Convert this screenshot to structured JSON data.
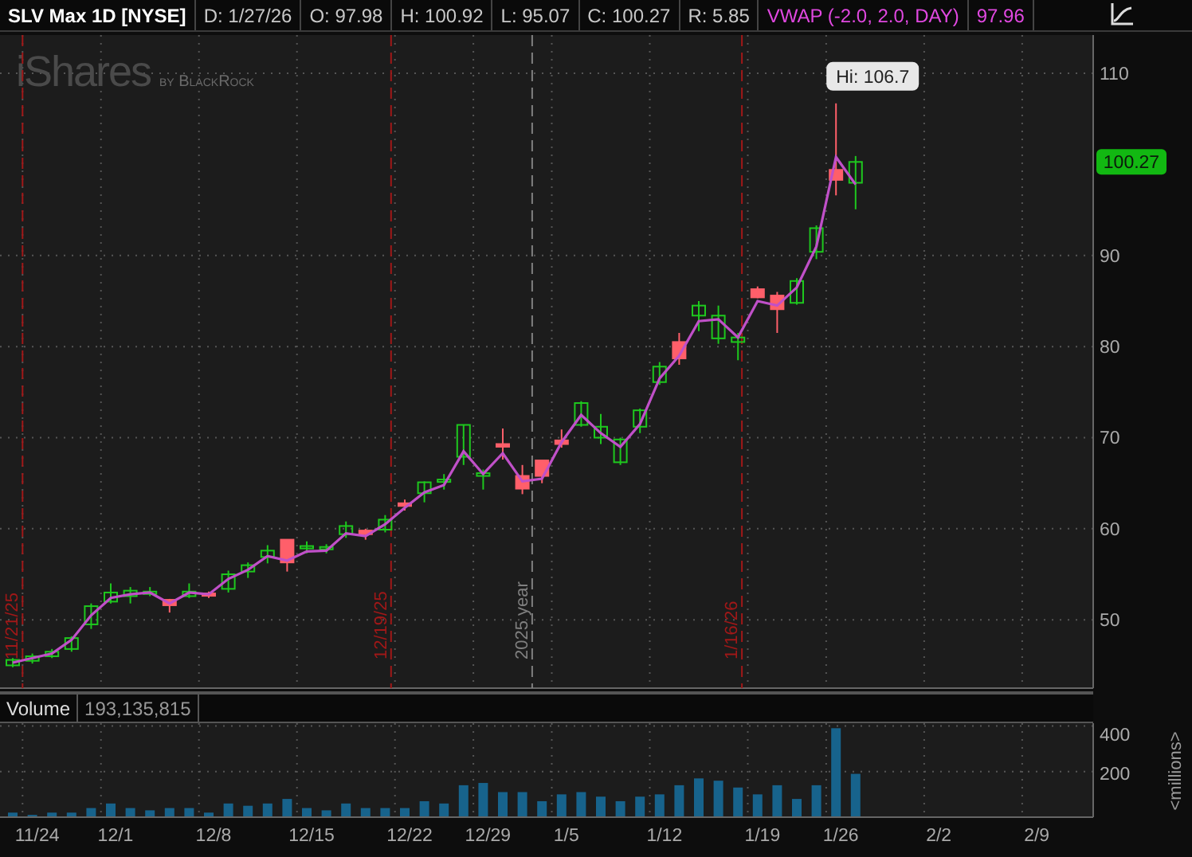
{
  "header": {
    "symbol": "SLV Max 1D [NYSE]",
    "fields": [
      {
        "text": "D: 1/27/26",
        "color": "#c8c8c8"
      },
      {
        "text": "O: 97.98",
        "color": "#c8c8c8"
      },
      {
        "text": "H: 100.92",
        "color": "#c8c8c8"
      },
      {
        "text": "L: 95.07",
        "color": "#c8c8c8"
      },
      {
        "text": "C: 100.27",
        "color": "#c8c8c8"
      },
      {
        "text": "R: 5.85",
        "color": "#c8c8c8"
      },
      {
        "text": "VWAP (-2.0, 2.0, DAY)",
        "color": "#e048e0"
      },
      {
        "text": "97.96",
        "color": "#e048e0"
      }
    ]
  },
  "price_chart": {
    "logo": {
      "name": "iShares",
      "byline": "by BlackRock"
    },
    "markers": [
      {
        "label": "11/21/25",
        "color": "#a01818"
      },
      {
        "label": "12/19/25",
        "color": "#a01818"
      },
      {
        "label": "2025 year",
        "color": "#808080"
      },
      {
        "label": "1/16/26",
        "color": "#a01818"
      }
    ],
    "chart_data": {
      "type": "candlestick",
      "ohlc": [
        [
          45.0,
          45.8,
          44.8,
          45.6
        ],
        [
          45.5,
          46.3,
          45.2,
          46.0
        ],
        [
          46.0,
          46.8,
          45.8,
          46.5
        ],
        [
          46.8,
          48.2,
          46.5,
          48.0
        ],
        [
          49.5,
          51.8,
          49.0,
          51.5
        ],
        [
          52.0,
          54.0,
          51.8,
          53.0
        ],
        [
          52.6,
          53.6,
          51.8,
          53.2
        ],
        [
          52.9,
          53.6,
          52.6,
          53.1
        ],
        [
          52.2,
          52.3,
          50.8,
          51.6
        ],
        [
          52.6,
          54.0,
          52.4,
          53.1
        ],
        [
          52.9,
          53.1,
          52.4,
          52.7
        ],
        [
          53.4,
          55.4,
          53.0,
          55.0
        ],
        [
          55.3,
          56.3,
          54.6,
          56.0
        ],
        [
          56.9,
          58.2,
          56.2,
          57.6
        ],
        [
          58.8,
          58.8,
          55.3,
          56.3
        ],
        [
          57.9,
          58.6,
          57.3,
          58.1
        ],
        [
          57.8,
          58.3,
          57.3,
          58.0
        ],
        [
          59.4,
          60.8,
          59.0,
          60.3
        ],
        [
          59.8,
          60.0,
          58.8,
          59.4
        ],
        [
          59.9,
          61.5,
          59.6,
          61.0
        ],
        [
          62.8,
          63.2,
          62.0,
          62.5
        ],
        [
          63.9,
          65.2,
          62.9,
          65.1
        ],
        [
          65.2,
          66.0,
          64.3,
          65.4
        ],
        [
          67.9,
          71.4,
          67.0,
          71.4
        ],
        [
          65.8,
          66.5,
          64.3,
          66.1
        ],
        [
          69.3,
          71.0,
          67.6,
          69.0
        ],
        [
          65.8,
          67.0,
          63.8,
          64.4
        ],
        [
          67.5,
          67.5,
          65.0,
          65.8
        ],
        [
          69.7,
          70.9,
          68.9,
          69.3
        ],
        [
          71.4,
          74.0,
          71.2,
          73.8
        ],
        [
          70.0,
          72.6,
          69.3,
          71.2
        ],
        [
          67.3,
          70.0,
          67.0,
          69.8
        ],
        [
          71.2,
          73.2,
          70.5,
          73.0
        ],
        [
          76.1,
          78.3,
          75.8,
          77.8
        ],
        [
          80.5,
          81.5,
          78.0,
          78.7
        ],
        [
          83.4,
          85.0,
          81.7,
          84.5
        ],
        [
          80.9,
          84.5,
          80.3,
          83.4
        ],
        [
          80.5,
          81.5,
          78.5,
          81.0
        ],
        [
          86.3,
          86.6,
          85.3,
          85.4
        ],
        [
          85.6,
          86.0,
          81.5,
          84.1
        ],
        [
          84.8,
          87.5,
          84.6,
          87.2
        ],
        [
          90.4,
          93.3,
          89.6,
          93.0
        ],
        [
          99.4,
          106.7,
          96.6,
          98.3
        ],
        [
          97.98,
          100.92,
          95.07,
          100.27
        ]
      ],
      "series": [
        {
          "type": "line",
          "color": "#c050c8",
          "values": [
            45.3,
            45.8,
            46.3,
            47.8,
            50.5,
            52.4,
            52.8,
            53.0,
            51.8,
            53.0,
            52.8,
            54.5,
            55.5,
            57.0,
            56.5,
            57.5,
            57.6,
            59.5,
            59.2,
            60.5,
            62.3,
            64.0,
            64.8,
            68.5,
            66.0,
            68.3,
            65.2,
            65.5,
            69.5,
            72.5,
            70.5,
            69.0,
            71.5,
            76.5,
            79.0,
            82.8,
            83.0,
            81.0,
            85.0,
            84.5,
            86.5,
            91.0,
            100.8,
            97.8
          ]
        }
      ],
      "ylim": [
        42.5,
        114.2
      ],
      "yticks": [
        50,
        60,
        70,
        80,
        90,
        110
      ],
      "grid": true,
      "annotations": [
        "Hi: 106.7",
        "100.27"
      ]
    }
  },
  "volume_chart": {
    "reading": "193,135,815",
    "chart_data": {
      "type": "bar",
      "categories": [
        null,
        "11/24",
        null,
        null,
        null,
        "12/1",
        null,
        null,
        null,
        null,
        "12/8",
        null,
        null,
        null,
        null,
        "12/15",
        null,
        null,
        null,
        null,
        "12/22",
        null,
        null,
        null,
        "12/29",
        null,
        null,
        null,
        "1/5",
        null,
        null,
        null,
        null,
        "1/12",
        null,
        null,
        null,
        null,
        "1/19",
        null,
        null,
        null,
        "1/26",
        null,
        null,
        null,
        null,
        "2/2",
        null,
        null,
        null,
        null,
        "2/9",
        null,
        null
      ],
      "ylabel": "<millions>",
      "series": [
        {
          "name": "Volume",
          "color": "#17638c",
          "values": [
            20,
            10,
            20,
            20,
            40,
            60,
            40,
            30,
            40,
            40,
            20,
            60,
            50,
            60,
            80,
            40,
            30,
            60,
            40,
            40,
            40,
            70,
            60,
            140,
            150,
            110,
            110,
            70,
            100,
            110,
            90,
            70,
            90,
            100,
            140,
            170,
            160,
            130,
            100,
            140,
            80,
            140,
            390,
            190,
            null,
            null,
            null,
            null,
            null,
            null,
            null,
            null,
            null,
            null,
            null
          ]
        }
      ],
      "ylim": [
        0,
        412
      ],
      "grid": true,
      "yticks": [
        200,
        400
      ]
    }
  }
}
